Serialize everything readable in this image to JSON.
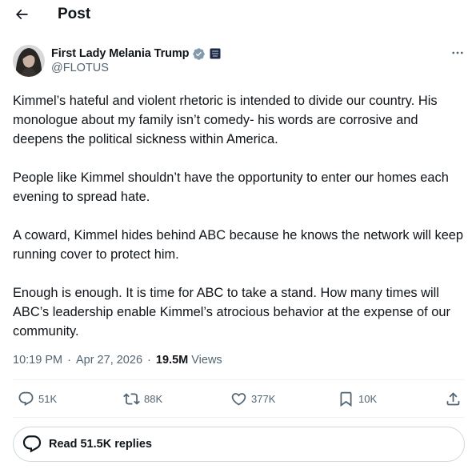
{
  "header": {
    "title": "Post"
  },
  "author": {
    "name": "First Lady Melania Trump",
    "handle": "@FLOTUS"
  },
  "tweet": {
    "paragraphs": [
      "Kimmel’s hateful and violent rhetoric is intended to divide our country. His monologue about my family isn’t comedy- his words are corrosive and deepens the political sickness within America.",
      "People like Kimmel shouldn’t have the opportunity to enter our homes each evening to spread hate.",
      "A coward, Kimmel hides behind ABC because he knows the network will keep running cover to protect him.",
      "Enough is enough.  It is time for ABC to take a stand.  How many times will ABC’s leadership enable Kimmel’s atrocious behavior at the expense of our community."
    ],
    "time": "10:19 PM",
    "date": "Apr 27, 2026",
    "views_count": "19.5M",
    "views_label": "Views"
  },
  "actions": {
    "replies": "51K",
    "reposts": "88K",
    "likes": "377K",
    "bookmarks": "10K"
  },
  "read_replies": {
    "label": "Read 51.5K replies"
  },
  "colors": {
    "text": "#0f1419",
    "secondary": "#536471",
    "verified_badge": "#829aab",
    "border": "#cfd9de"
  },
  "icons": [
    "back-arrow-icon",
    "verified-badge-icon",
    "affiliation-icon",
    "more-icon",
    "reply-icon",
    "repost-icon",
    "like-icon",
    "bookmark-icon",
    "share-icon",
    "speech-bubble-icon"
  ]
}
